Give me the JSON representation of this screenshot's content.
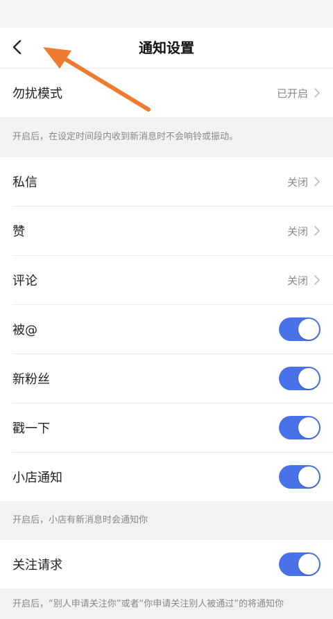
{
  "header": {
    "title": "通知设置"
  },
  "dnd": {
    "label": "勿扰模式",
    "value": "已开启"
  },
  "dnd_desc": "开启后，在设定时间段内收到新消息时不会响铃或振动。",
  "rows": [
    {
      "label": "私信",
      "value": "关闭"
    },
    {
      "label": "赞",
      "value": "关闭"
    },
    {
      "label": "评论",
      "value": "关闭"
    }
  ],
  "toggles": [
    {
      "label": "被@",
      "on": true
    },
    {
      "label": "新粉丝",
      "on": true
    },
    {
      "label": "戳一下",
      "on": true
    },
    {
      "label": "小店通知",
      "on": true
    }
  ],
  "shop_desc": "开启后，小店有新消息时会通知你",
  "follow": {
    "label": "关注请求",
    "on": true
  },
  "follow_desc": "开启后，“别人申请关注你”或者“你申请关注别人被通过”的将通知你",
  "colors": {
    "toggle_on": "#4a72e8",
    "annotation_arrow": "#f07a30"
  },
  "icons": {
    "back": "chevron-left-icon",
    "row": "chevron-right-icon"
  }
}
